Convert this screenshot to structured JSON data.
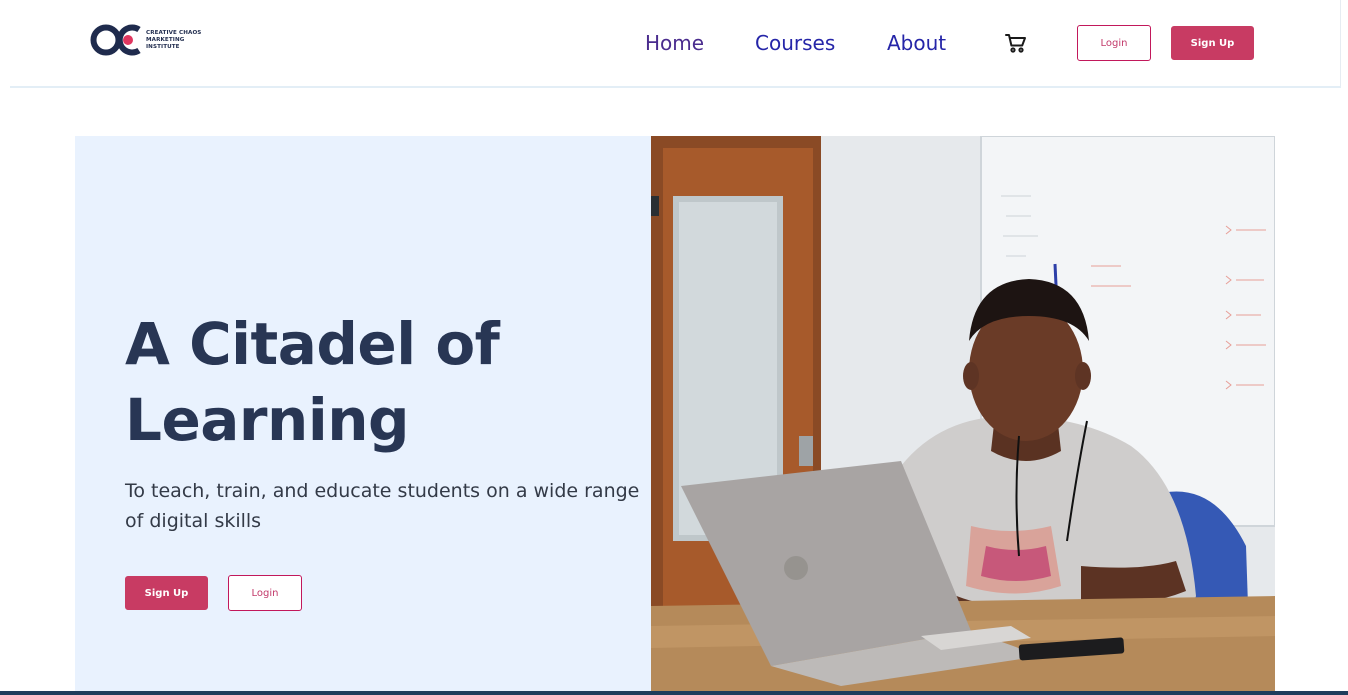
{
  "brand": {
    "logo_letters": "OC",
    "name_lines": [
      "CREATIVE CHAOS",
      "MARKETING",
      "INSTITUTE"
    ],
    "accent_color": "#e0365f",
    "dark_color": "#1f2b4d"
  },
  "nav": {
    "home": "Home",
    "courses": "Courses",
    "about": "About",
    "cart_icon": "cart-icon"
  },
  "header_buttons": {
    "login": "Login",
    "signup": "Sign Up"
  },
  "hero": {
    "title": "A Citadel of Learning",
    "subtitle": "To teach, train, and educate students on a wide range of digital skills",
    "signup": "Sign Up",
    "login": "Login",
    "background_color": "#e9f2fe"
  },
  "colors": {
    "primary_button": "#c83b63",
    "nav_link": "#2525a8",
    "title_text": "#283654"
  }
}
